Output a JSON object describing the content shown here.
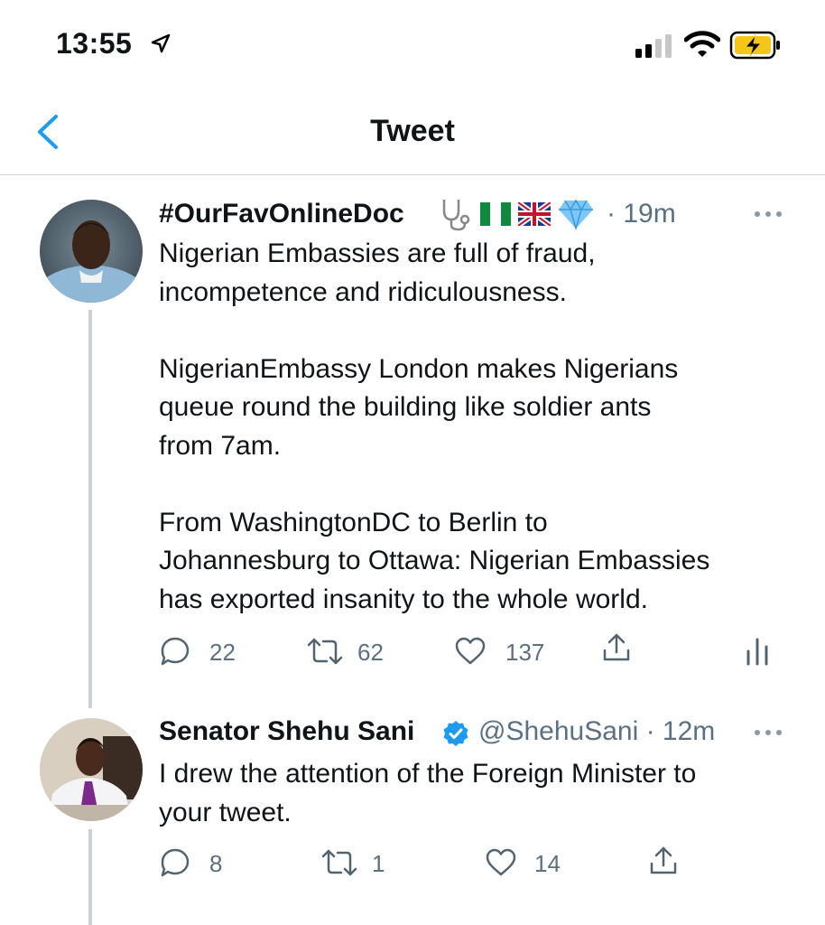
{
  "status_bar": {
    "time": "13:55"
  },
  "nav": {
    "title": "Tweet"
  },
  "tweets": [
    {
      "display_name": "#OurFavOnlineDoc",
      "name_emojis": [
        "stethoscope-emoji",
        "nigeria-flag-emoji",
        "uk-flag-emoji",
        "gem-emoji"
      ],
      "meta": "· 19m",
      "text": "Nigerian Embassies are full of fraud,\nincompetence and ridiculousness.\n\nNigerianEmbassy London makes Nigerians\nqueue round the building like soldier ants\nfrom 7am.\n\nFrom WashingtonDC to Berlin to\nJohannesburg to Ottawa: Nigerian Embassies\nhas exported insanity to the whole world.",
      "replies": "22",
      "retweets": "62",
      "likes": "137"
    },
    {
      "display_name": "Senator Shehu Sani",
      "verified": true,
      "handle_time": "@ShehuSani · 12m",
      "text": "I drew the attention of the Foreign Minister to\nyour tweet.",
      "replies": "8",
      "retweets": "1",
      "likes": "14"
    }
  ],
  "colors": {
    "accent": "#1d9bf0",
    "muted": "#5b7083",
    "thread_line": "#c8d2da"
  }
}
